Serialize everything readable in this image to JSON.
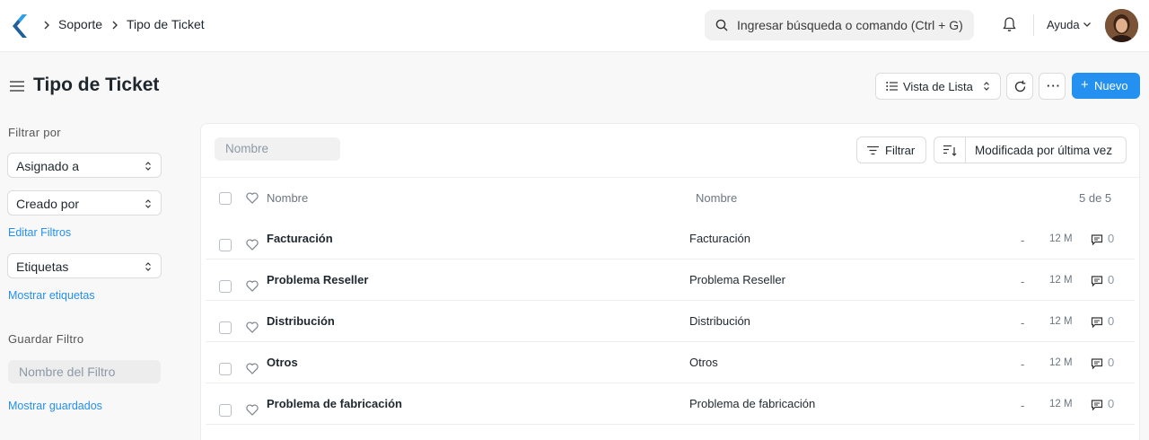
{
  "navbar": {
    "breadcrumbs": [
      "Soporte",
      "Tipo de Ticket"
    ],
    "search_placeholder": "Ingresar búsqueda o comando (Ctrl + G)",
    "help_label": "Ayuda"
  },
  "page": {
    "title": "Tipo de Ticket",
    "view_label": "Vista de Lista",
    "more_label": "···",
    "new_label": "Nuevo"
  },
  "sidebar": {
    "filter_by_label": "Filtrar por",
    "assigned_label": "Asignado a",
    "created_by_label": "Creado por",
    "edit_filters_label": "Editar Filtros",
    "tags_label": "Etiquetas",
    "show_tags_label": "Mostrar etiquetas",
    "save_filter_label": "Guardar Filtro",
    "filter_name_placeholder": "Nombre del Filtro",
    "show_saved_label": "Mostrar guardados"
  },
  "list": {
    "name_filter_placeholder": "Nombre",
    "filter_label": "Filtrar",
    "sort_label": "Modificada por última vez",
    "col_name": "Nombre",
    "col_name2": "Nombre",
    "count": "5 de 5",
    "rows": [
      {
        "name": "Facturación",
        "value": "Facturación",
        "dash": "-",
        "time": "12 M",
        "comments": "0"
      },
      {
        "name": "Problema Reseller",
        "value": "Problema Reseller",
        "dash": "-",
        "time": "12 M",
        "comments": "0"
      },
      {
        "name": "Distribución",
        "value": "Distribución",
        "dash": "-",
        "time": "12 M",
        "comments": "0"
      },
      {
        "name": "Otros",
        "value": "Otros",
        "dash": "-",
        "time": "12 M",
        "comments": "0"
      },
      {
        "name": "Problema de fabricación",
        "value": "Problema de fabricación",
        "dash": "-",
        "time": "12 M",
        "comments": "0"
      }
    ]
  },
  "colors": {
    "accent": "#2490ef",
    "logo": "#1f5f9c"
  }
}
